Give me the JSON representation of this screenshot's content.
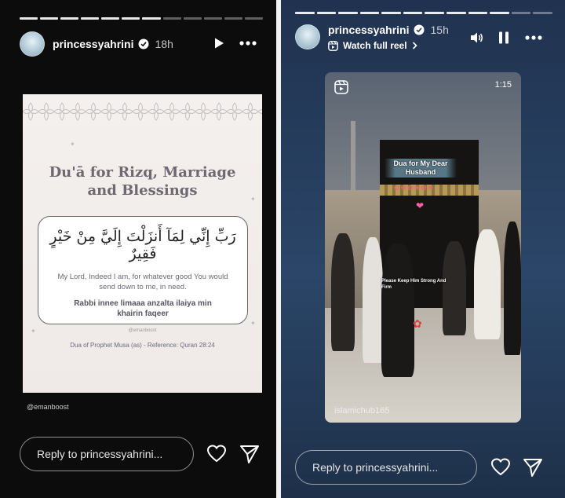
{
  "left_story": {
    "username": "princessyahrini",
    "time": "18h",
    "reply_placeholder": "Reply to princessyahrini...",
    "progress_total": 12,
    "progress_done": 7,
    "card": {
      "title_line1": "Du'ā for Rizq, Marriage",
      "title_line2": "and Blessings",
      "arabic": "رَبِّ إِنِّي لِمَآ أَنزَلْتَ إِلَيَّ مِنْ خَيْرٍ فَقِيرٌ",
      "english_line1": "My Lord, Indeed I am, for whatever good You would",
      "english_line2": "send down to me, in need.",
      "translit_line1": "Rabbi innee limaaa anzalta ilaiya min",
      "translit_line2": "khairin faqeer",
      "small_handle": "@emanboost",
      "reference": "Dua of Prophet Musa (as) - Reference: Quran 28:24"
    },
    "credit": "@emanboost"
  },
  "right_story": {
    "username": "princessyahrini",
    "time": "15h",
    "watch_reel": "Watch full reel",
    "reply_placeholder": "Reply to princessyahrini...",
    "progress_total": 12,
    "progress_done": 10,
    "reel": {
      "duration": "1:15",
      "caption_line1": "Dua for My Dear",
      "caption_line2": "Husband",
      "caption_bottom_line1": "Please Keep Him Strong And",
      "caption_bottom_line2": "Firm",
      "handle": "islamichub165"
    }
  },
  "colors": {
    "left_bg": "#0c0c0c",
    "right_bg": "#2b4668",
    "verified": "#1c96f0"
  },
  "icons": [
    "verified-badge-icon",
    "play-icon",
    "more-icon",
    "heart-icon",
    "send-icon",
    "volume-icon",
    "pause-icon",
    "reel-icon",
    "chevron-right-icon"
  ]
}
